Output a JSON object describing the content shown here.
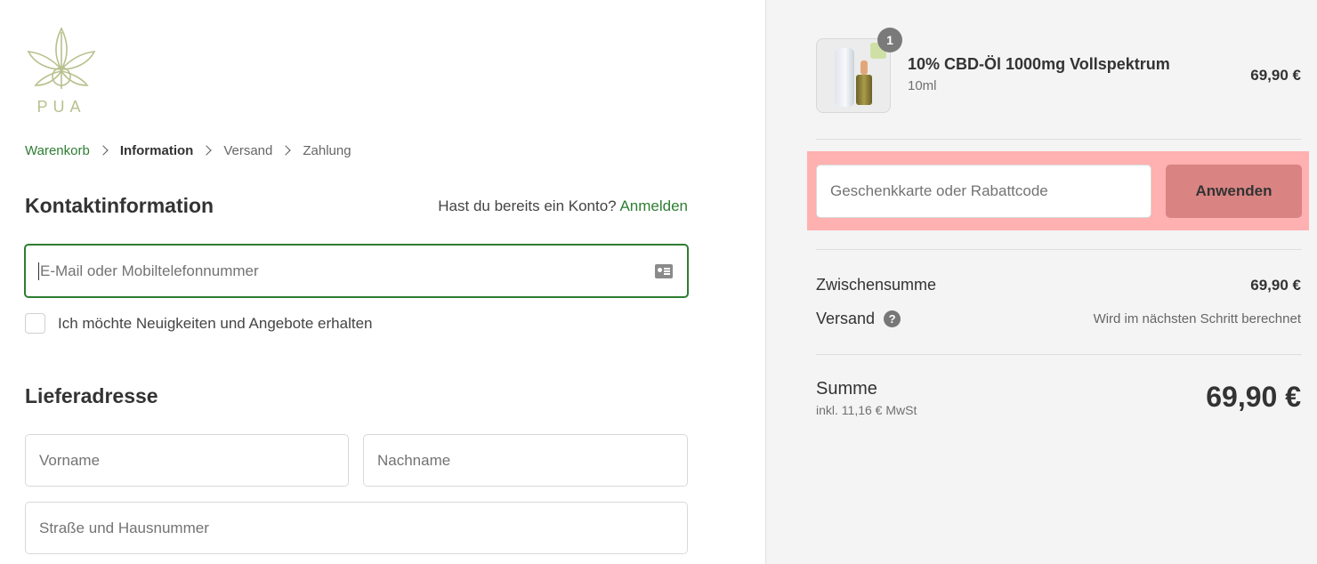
{
  "brand": {
    "logo_text": "PUA",
    "logo_color": "#b9c08e"
  },
  "breadcrumb": [
    {
      "label": "Warenkorb",
      "state": "link"
    },
    {
      "label": "Information",
      "state": "current"
    },
    {
      "label": "Versand",
      "state": "upcoming"
    },
    {
      "label": "Zahlung",
      "state": "upcoming"
    }
  ],
  "contact": {
    "title": "Kontaktinformation",
    "account_prompt": "Hast du bereits ein Konto?",
    "login_link": "Anmelden",
    "email_placeholder": "E-Mail oder Mobiltelefonnummer",
    "email_icon": "contact-card-icon",
    "newsletter_label": "Ich möchte Neuigkeiten und Angebote erhalten",
    "newsletter_checked": false
  },
  "delivery": {
    "title": "Lieferadresse",
    "first_name_placeholder": "Vorname",
    "last_name_placeholder": "Nachname",
    "street_placeholder": "Straße und Hausnummer"
  },
  "order": {
    "items": [
      {
        "quantity": "1",
        "name": "10% CBD-Öl 1000mg Vollspektrum",
        "variant": "10ml",
        "price": "69,90 €"
      }
    ],
    "discount_placeholder": "Geschenkkarte oder Rabattcode",
    "apply_label": "Anwenden",
    "subtotal_label": "Zwischensumme",
    "subtotal_value": "69,90 €",
    "shipping_label": "Versand",
    "shipping_help_icon": "question-circle-icon",
    "shipping_value": "Wird im nächsten Schritt berechnet",
    "total_label": "Summe",
    "tax_note": "inkl. 11,16 € MwSt",
    "total_value": "69,90 €"
  },
  "colors": {
    "accent": "#2e7d32",
    "highlight": "#ffb0b0",
    "apply_button": "#d98383",
    "sidebar_bg": "#f4f4f4"
  }
}
